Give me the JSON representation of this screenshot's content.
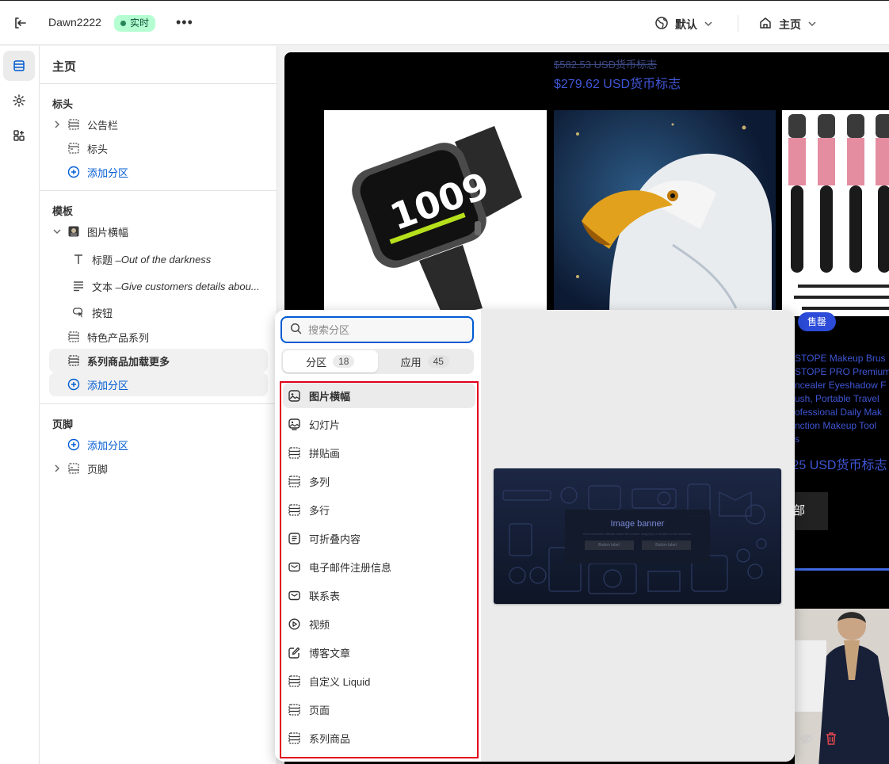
{
  "topbar": {
    "store_name": "Dawn2222",
    "live_badge": "实时",
    "more_label": "•••",
    "theme_label": "默认",
    "page_label": "主页"
  },
  "sidebar": {
    "title": "主页",
    "header_section": {
      "heading": "标头",
      "items": [
        {
          "label": "公告栏"
        },
        {
          "label": "标头"
        }
      ],
      "add_label": "添加分区"
    },
    "template_section": {
      "heading": "模板",
      "banner_label": "图片横幅",
      "banner_children": [
        {
          "prefix": "标题 – ",
          "label": "Out of the darkness"
        },
        {
          "prefix": "文本 – ",
          "label": "Give customers details abou..."
        },
        {
          "prefix": "",
          "label": "按钮"
        }
      ],
      "featured_label": "特色产品系列",
      "collection_more_label": "系列商品加载更多",
      "add_label": "添加分区"
    },
    "footer_section": {
      "heading": "页脚",
      "add_label": "添加分区",
      "footer_label": "页脚"
    }
  },
  "preview": {
    "price_old": "$582.53 USD货币标志",
    "price_new": "$279.62 USD货币标志",
    "sale_tag": "售罄",
    "product_lines": [
      "STOPE Makeup Brus",
      "STOPE PRO Premium",
      "ncealer Eyeshadow F",
      "ush, Portable Travel",
      "ofessional Daily Mak",
      "nction Makeup Tool"
    ],
    "product_tail": "s",
    "product_price": ".25 USD货币标志",
    "product_button": "部",
    "watch_display": "1009"
  },
  "popover": {
    "search_placeholder": "搜索分区",
    "tabs": [
      {
        "label": "分区",
        "count": "18"
      },
      {
        "label": "应用",
        "count": "45"
      }
    ],
    "items": [
      {
        "label": "图片横幅",
        "icon": "image-banner-icon"
      },
      {
        "label": "幻灯片",
        "icon": "slideshow-icon"
      },
      {
        "label": "拼贴画",
        "icon": "section-icon"
      },
      {
        "label": "多列",
        "icon": "section-icon"
      },
      {
        "label": "多行",
        "icon": "section-icon"
      },
      {
        "label": "可折叠内容",
        "icon": "collapsible-icon"
      },
      {
        "label": "电子邮件注册信息",
        "icon": "email-icon"
      },
      {
        "label": "联系表",
        "icon": "email-icon"
      },
      {
        "label": "视频",
        "icon": "play-icon"
      },
      {
        "label": "博客文章",
        "icon": "edit-icon"
      },
      {
        "label": "自定义 Liquid",
        "icon": "section-icon"
      },
      {
        "label": "页面",
        "icon": "section-icon"
      },
      {
        "label": "系列商品",
        "icon": "section-icon"
      }
    ],
    "preview_card": {
      "title": "Image banner",
      "subtitle": "Give customers details about the banner image(s) or content on the template.",
      "button1": "Button label",
      "button2": "Button label"
    }
  },
  "colors": {
    "accent": "#005bd3",
    "live_badge_bg": "#b4fed2",
    "live_badge_text": "#0c5132",
    "highlight_border": "#e1001a",
    "price_blue": "#3f56d6"
  }
}
